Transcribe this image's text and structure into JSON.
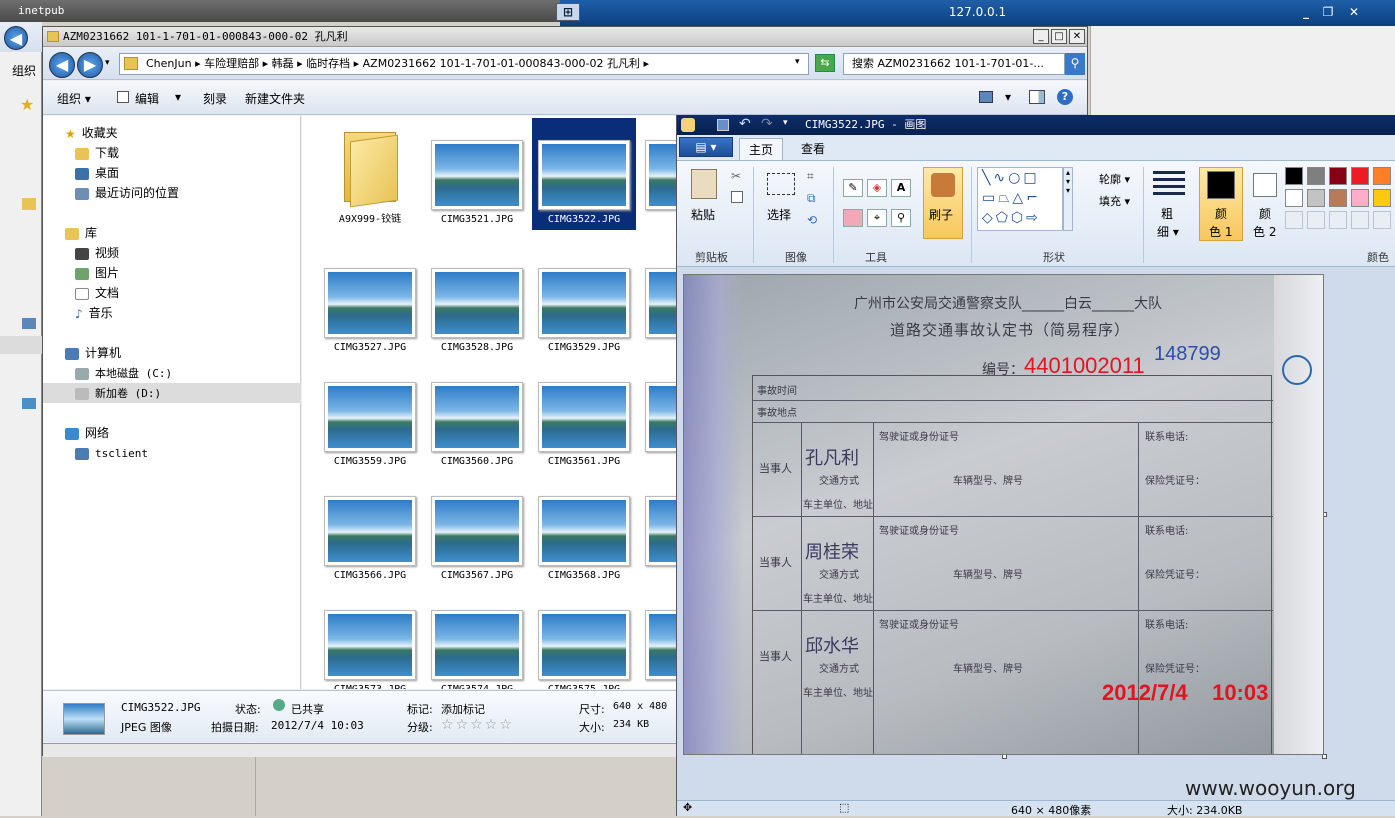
{
  "rdp": {
    "host": "127.0.0.1",
    "pin": "⊞"
  },
  "back_window": {
    "title": "inetpub",
    "toolbar": "组织"
  },
  "explorer": {
    "title": "AZM0231662 101-1-701-01-000843-000-02 孔凡利",
    "address": "ChenJun ▸ 车险理赔部 ▸ 韩磊 ▸ 临时存档 ▸ AZM0231662 101-1-701-01-000843-000-02 孔凡利 ▸",
    "search_placeholder": "搜索 AZM0231662 101-1-701-01-...",
    "toolbar": {
      "organize": "组织 ▾",
      "edit": "编辑",
      "burn": "刻录",
      "new_folder": "新建文件夹"
    },
    "sidebar": {
      "favorites": "收藏夹",
      "downloads": "下载",
      "desktop": "桌面",
      "recent": "最近访问的位置",
      "libraries": "库",
      "videos": "视频",
      "pictures": "图片",
      "documents": "文档",
      "music": "音乐",
      "computer": "计算机",
      "local_disk": "本地磁盘 (C:)",
      "new_volume": "新加卷 (D:)",
      "network": "网络",
      "tsclient": "tsclient"
    },
    "files": [
      {
        "name": "A9X999-铰链",
        "type": "folder"
      },
      {
        "name": "CIMG3521.JPG"
      },
      {
        "name": "CIMG3522.JPG",
        "selected": true
      },
      {
        "name": "CIMG"
      },
      {
        "name": "CIMG3527.JPG"
      },
      {
        "name": "CIMG3528.JPG"
      },
      {
        "name": "CIMG3529.JPG"
      },
      {
        "name": "CIMG"
      },
      {
        "name": "CIMG3559.JPG"
      },
      {
        "name": "CIMG3560.JPG"
      },
      {
        "name": "CIMG3561.JPG"
      },
      {
        "name": "CIMG"
      },
      {
        "name": "CIMG3566.JPG"
      },
      {
        "name": "CIMG3567.JPG"
      },
      {
        "name": "CIMG3568.JPG"
      },
      {
        "name": "CIMG"
      },
      {
        "name": "CIMG3573.JPG"
      },
      {
        "name": "CIMG3574.JPG"
      },
      {
        "name": "CIMG3575.JPG"
      },
      {
        "name": "CIMG"
      }
    ],
    "details": {
      "filename": "CIMG3522.JPG",
      "filetype": "JPEG 图像",
      "state_label": "状态:",
      "state_value": "已共享",
      "date_label": "拍摄日期:",
      "date_value": "2012/7/4 10:03",
      "tag_label": "标记:",
      "tag_value": "添加标记",
      "rating_label": "分级:",
      "rating_value": "☆☆☆☆☆",
      "dim_label": "尺寸:",
      "dim_value": "640 x 480",
      "size_label": "大小:",
      "size_value": "234 KB"
    }
  },
  "paint": {
    "title": "CIMG3522.JPG - 画图",
    "tabs": {
      "home": "主页",
      "view": "查看"
    },
    "ribbon": {
      "paste": "粘贴",
      "clipboard": "剪贴板",
      "select": "选择",
      "image": "图像",
      "tools": "工具",
      "brush": "刷子",
      "outline": "轮廓 ▾",
      "fill": "填充 ▾",
      "shapes": "形状",
      "thickness": "粗\n细",
      "thickness_l1": "粗",
      "thickness_l2": "细 ▾",
      "color1_l1": "颜",
      "color1_l2": "色 1",
      "color2_l1": "颜",
      "color2_l2": "色 2",
      "colors": "颜色"
    },
    "palette": [
      "#000000",
      "#7f7f7f",
      "#880015",
      "#ed1c24",
      "#ff7f27",
      "#ffffff",
      "#c3c3c3",
      "#b97a57",
      "#ffaec9",
      "#ffc90e"
    ],
    "document": {
      "header": "广州市公安局交通警察支队______白云______大队",
      "title": "道路交通事故认定书（简易程序）",
      "serial_label": "编号：",
      "serial_stamp": "4401002011",
      "serial_blue": "148799",
      "row_time": "事故时间",
      "row_place": "事故地点",
      "party": "当事人",
      "license": "驾驶证或身份证号",
      "phone": "联系电话:",
      "transport": "交通方式",
      "plate": "车辆型号、牌号",
      "insurance": "保险凭证号：",
      "unit": "车主单位、地址",
      "party_a": "孔凡利",
      "party_b": "周桂荣",
      "party_c": "邱水华",
      "date_stamp": "2012/7/4    10:03"
    },
    "status": {
      "dim": "640 × 480像素",
      "size": "大小: 234.0KB"
    }
  },
  "watermark": "www.wooyun.org"
}
